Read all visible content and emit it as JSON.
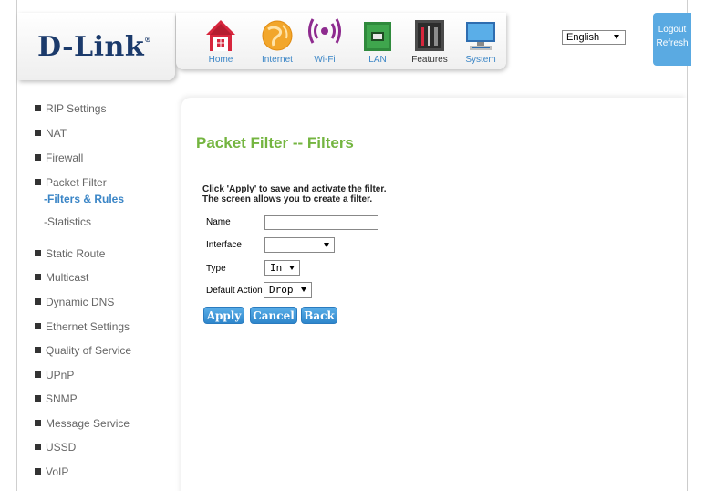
{
  "brand": {
    "logo": "D-Link",
    "trademark": "®"
  },
  "nav": [
    {
      "label": "Home",
      "icon": "home-icon"
    },
    {
      "label": "Internet",
      "icon": "globe-icon"
    },
    {
      "label": "Wi-Fi",
      "icon": "wifi-icon"
    },
    {
      "label": "LAN",
      "icon": "lan-icon"
    },
    {
      "label": "Features",
      "icon": "features-icon"
    },
    {
      "label": "System",
      "icon": "monitor-icon"
    }
  ],
  "language": {
    "selected": "English"
  },
  "account": {
    "logout": "Logout",
    "refresh": "Refresh"
  },
  "sidebar": {
    "items": [
      {
        "label": "RIP Settings"
      },
      {
        "label": "NAT"
      },
      {
        "label": "Firewall"
      },
      {
        "label": "Packet Filter"
      },
      {
        "label": "Static Route"
      },
      {
        "label": "Multicast"
      },
      {
        "label": "Dynamic DNS"
      },
      {
        "label": "Ethernet Settings"
      },
      {
        "label": "Quality of Service"
      },
      {
        "label": "UPnP"
      },
      {
        "label": "SNMP"
      },
      {
        "label": "Message Service"
      },
      {
        "label": "USSD"
      },
      {
        "label": "VoIP"
      }
    ],
    "packet_filter_sub": [
      {
        "label": "-Filters & Rules"
      },
      {
        "label": "-Statistics"
      }
    ]
  },
  "page": {
    "title": "Packet Filter -- Filters",
    "intro_line1": "Click 'Apply' to save and activate the filter.",
    "intro_line2": "The screen allows you to create a filter."
  },
  "form": {
    "name_label": "Name",
    "name_value": "",
    "interface_label": "Interface",
    "interface_value": "",
    "type_label": "Type",
    "type_value": "In",
    "default_action_label": "Default Action",
    "default_action_value": "Drop"
  },
  "buttons": {
    "apply": "Apply",
    "cancel": "Cancel",
    "back": "Back"
  },
  "colors": {
    "accent_green": "#74b540",
    "link_blue": "#3a85c6",
    "button_blue": "#2e86cb"
  }
}
